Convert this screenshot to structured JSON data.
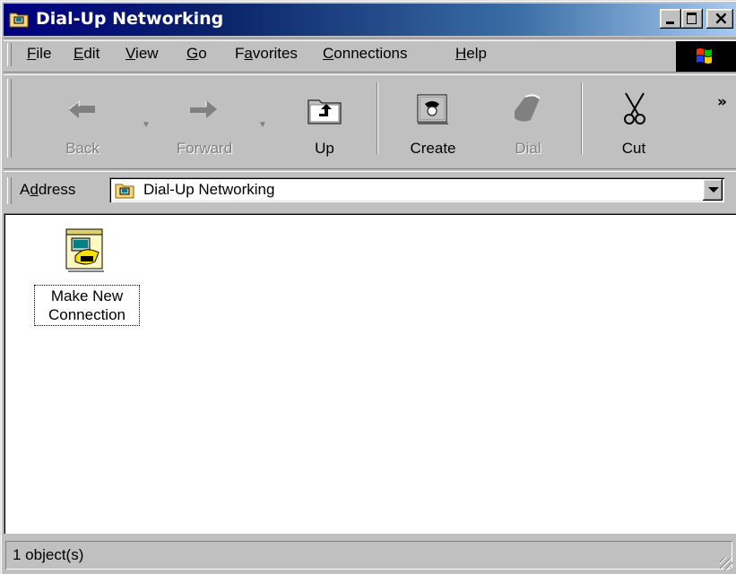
{
  "window": {
    "title": "Dial-Up Networking",
    "title_icon": "dialup-folder-icon",
    "colors": {
      "titlebar": "#000080",
      "face": "#c0c0c0"
    }
  },
  "menu": {
    "items": [
      {
        "label": "File",
        "accel": "F",
        "rest": "ile"
      },
      {
        "label": "Edit",
        "accel": "E",
        "rest": "dit"
      },
      {
        "label": "View",
        "accel": "V",
        "rest": "iew"
      },
      {
        "label": "Go",
        "accel": "G",
        "rest": "o"
      },
      {
        "label": "Favorites",
        "pre": "F",
        "accel": "a",
        "rest": "vorites"
      },
      {
        "label": "Connections",
        "accel": "C",
        "rest": "onnections"
      },
      {
        "label": "Help",
        "accel": "H",
        "rest": "elp"
      }
    ]
  },
  "toolbar": {
    "back_label": "Back",
    "forward_label": "Forward",
    "up_label": "Up",
    "create_label": "Create",
    "dial_label": "Dial",
    "cut_label": "Cut",
    "more_glyph": "»"
  },
  "address": {
    "label_pre": "A",
    "label_accel": "d",
    "label_rest": "dress",
    "value": "Dial-Up Networking"
  },
  "content": {
    "items": [
      {
        "line1": "Make New",
        "line2": "Connection",
        "icon": "make-new-connection-icon"
      }
    ]
  },
  "status": {
    "text": "1 object(s)"
  }
}
